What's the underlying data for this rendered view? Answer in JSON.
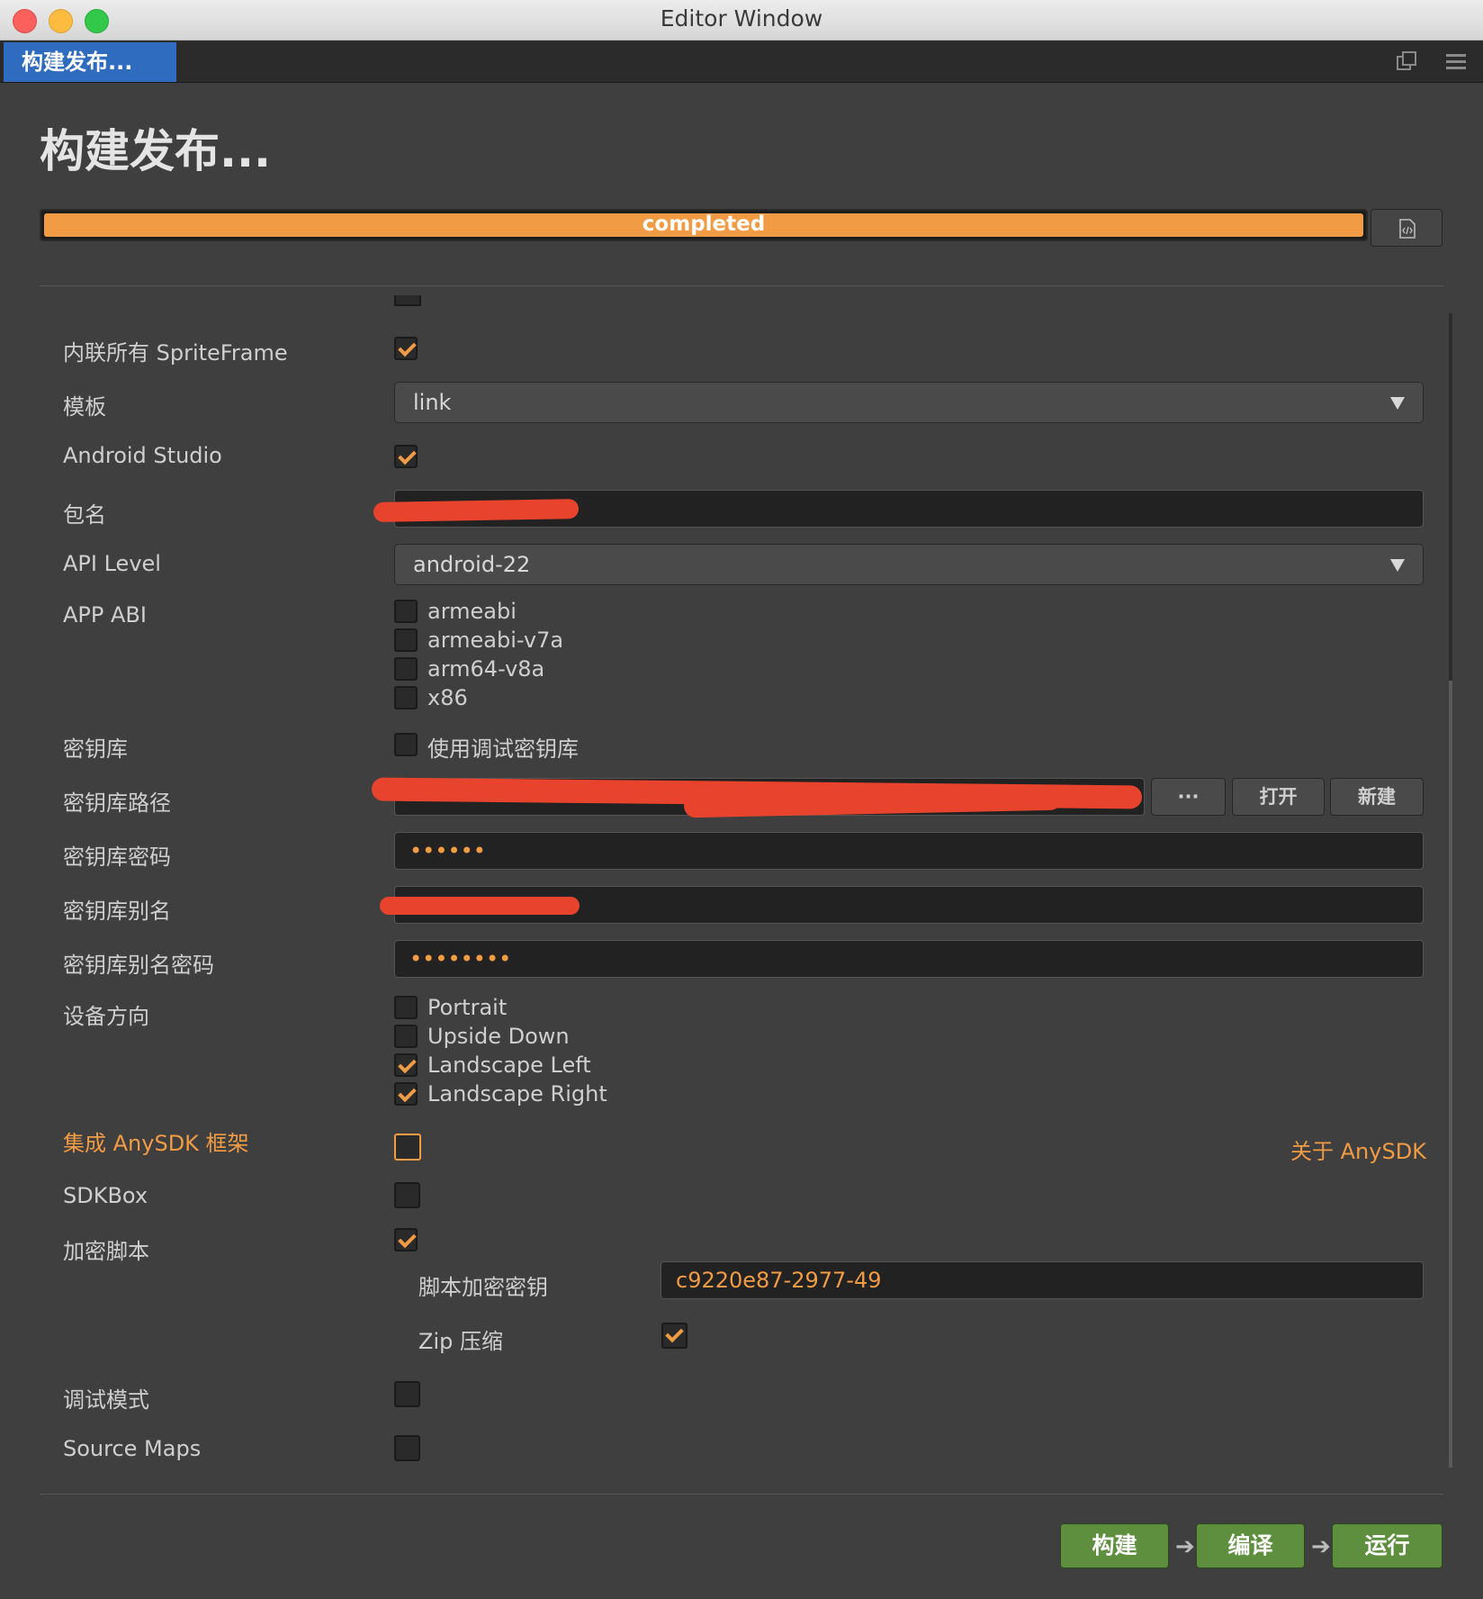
{
  "window": {
    "title": "Editor Window"
  },
  "tab": {
    "label": "构建发布..."
  },
  "header": {
    "title": "构建发布...",
    "progress_text": "completed",
    "progress_value": 1.0
  },
  "form": {
    "inline_spriteframe": {
      "label": "内联所有 SpriteFrame",
      "checked": true
    },
    "template": {
      "label": "模板",
      "value": "link"
    },
    "android_studio": {
      "label": "Android Studio",
      "checked": true
    },
    "package_name": {
      "label": "包名",
      "value": ""
    },
    "api_level": {
      "label": "API Level",
      "value": "android-22"
    },
    "app_abi": {
      "label": "APP ABI",
      "options": [
        {
          "label": "armeabi",
          "checked": false
        },
        {
          "label": "armeabi-v7a",
          "checked": false
        },
        {
          "label": "arm64-v8a",
          "checked": false
        },
        {
          "label": "x86",
          "checked": false
        }
      ]
    },
    "keystore": {
      "label": "密钥库",
      "debug_label": "使用调试密钥库",
      "checked": false
    },
    "keystore_path": {
      "label": "密钥库路径",
      "value": "",
      "browse_label": "···",
      "open_label": "打开",
      "new_label": "新建"
    },
    "keystore_password": {
      "label": "密钥库密码",
      "value": "••••••"
    },
    "keystore_alias": {
      "label": "密钥库别名",
      "value": ""
    },
    "alias_password": {
      "label": "密钥库别名密码",
      "value": "••••••••"
    },
    "orientation": {
      "label": "设备方向",
      "options": [
        {
          "label": "Portrait",
          "checked": false
        },
        {
          "label": "Upside Down",
          "checked": false
        },
        {
          "label": "Landscape Left",
          "checked": true
        },
        {
          "label": "Landscape Right",
          "checked": true
        }
      ]
    },
    "anysdk": {
      "label": "集成 AnySDK 框架",
      "checked": false,
      "link": "关于 AnySDK"
    },
    "sdkbox": {
      "label": "SDKBox",
      "checked": false
    },
    "encrypt_js": {
      "label": "加密脚本",
      "checked": true
    },
    "encrypt_key": {
      "label": "脚本加密密钥",
      "value": "c9220e87-2977-49"
    },
    "zip_compress": {
      "label": "Zip 压缩",
      "checked": true
    },
    "debug_mode": {
      "label": "调试模式",
      "checked": false
    },
    "source_maps": {
      "label": "Source Maps",
      "checked": false
    }
  },
  "actions": {
    "build": "构建",
    "compile": "编译",
    "run": "运行",
    "arrow": "➔"
  },
  "colors": {
    "accent": "#f19b45",
    "tab": "#2f6cbf",
    "action": "#5e8f3f",
    "redact": "#e8432c"
  }
}
